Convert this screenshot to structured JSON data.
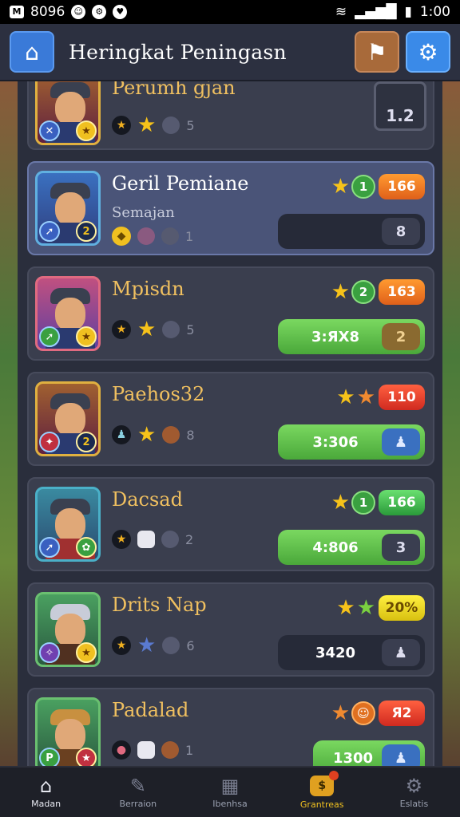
{
  "status_bar": {
    "left_text": "8096",
    "time": "1:00"
  },
  "header": {
    "title": "Heringkat Peningasn"
  },
  "partial_top": {
    "name": "Perumh gjan",
    "count": "5",
    "chest_value": "1.2"
  },
  "players": [
    {
      "name": "Geril Pemiane",
      "subtitle": "Semajan",
      "level": "1",
      "score": "166",
      "bar_value": "",
      "bar_end": "8",
      "count": "1",
      "avatar_badge": "2",
      "selected": true
    },
    {
      "name": "Mpisdn",
      "level": "2",
      "score": "163",
      "bar_value": "3:ЯX8",
      "bar_end": "2",
      "count": "5"
    },
    {
      "name": "Paehos32",
      "level": "",
      "score": "110",
      "bar_value": "3:306",
      "bar_end": "",
      "count": "8",
      "avatar_badge": "2"
    },
    {
      "name": "Dacsad",
      "level": "1",
      "score": "166",
      "bar_value": "4:806",
      "bar_end": "3",
      "count": "2"
    },
    {
      "name": "Drits Nap",
      "level": "",
      "score": "20%",
      "bar_value": "3420",
      "bar_end": "",
      "count": "6"
    },
    {
      "name": "Padalad",
      "level": "",
      "score": "Я2",
      "bar_value": "1300",
      "bar_end": "",
      "count": "1"
    }
  ],
  "nav": [
    {
      "label": "Madan",
      "icon": "home-icon"
    },
    {
      "label": "Berraion",
      "icon": "chat-icon"
    },
    {
      "label": "Ibenhsa",
      "icon": "building-icon"
    },
    {
      "label": "Grantreas",
      "icon": "treasure-icon"
    },
    {
      "label": "Eslatis",
      "icon": "gear-icon"
    }
  ]
}
